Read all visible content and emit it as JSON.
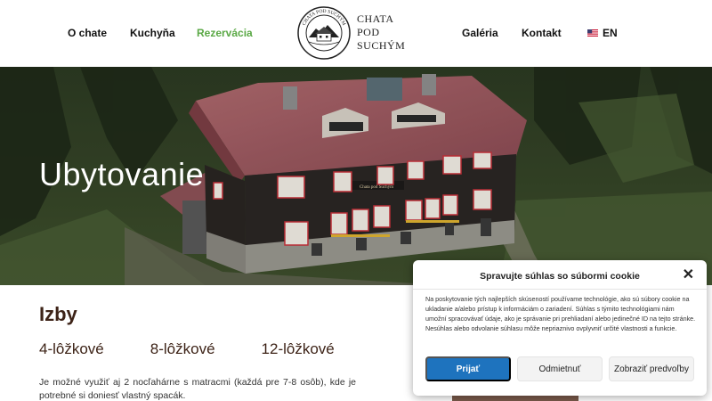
{
  "nav": {
    "left": [
      {
        "label": "O chate"
      },
      {
        "label": "Kuchyňa"
      },
      {
        "label": "Rezervácia"
      }
    ],
    "right": [
      {
        "label": "Galéria"
      },
      {
        "label": "Kontakt"
      }
    ],
    "language": {
      "label": "EN",
      "icon": "us-flag-icon"
    },
    "active_color": "#5aa845"
  },
  "logo": {
    "line1": "CHATA",
    "line2": "POD",
    "line3": "SUCHÝM",
    "seal_text": "CHATA POD SUCHÝM"
  },
  "hero": {
    "title": "Ubytovanie",
    "sign_text": "Chata pod Suchým"
  },
  "content": {
    "section_title": "Izby",
    "tabs": [
      {
        "label": "4-lôžkové"
      },
      {
        "label": "8-lôžkové"
      },
      {
        "label": "12-lôžkové"
      }
    ],
    "description": "Je možné využiť aj 2 nocľahárne s matracmi (každá pre 7-8 osôb), kde je potrebné si doniesť vlastný spacák."
  },
  "cookie": {
    "title": "Spravujte súhlas so súbormi cookie",
    "body": "Na poskytovanie tých najlepších skúseností používame technológie, ako sú súbory cookie na ukladanie a/alebo prístup k informáciám o zariadení. Súhlas s týmito technológiami nám umožní spracovávať údaje, ako je správanie pri prehliadaní alebo jedinečné ID na tejto stránke. Nesúhlas alebo odvolanie súhlasu môže nepriaznivo ovplyvniť určité vlastnosti a funkcie.",
    "accept_label": "Prijať",
    "deny_label": "Odmietnuť",
    "prefs_label": "Zobraziť predvoľby",
    "accent_color": "#1e73be"
  }
}
